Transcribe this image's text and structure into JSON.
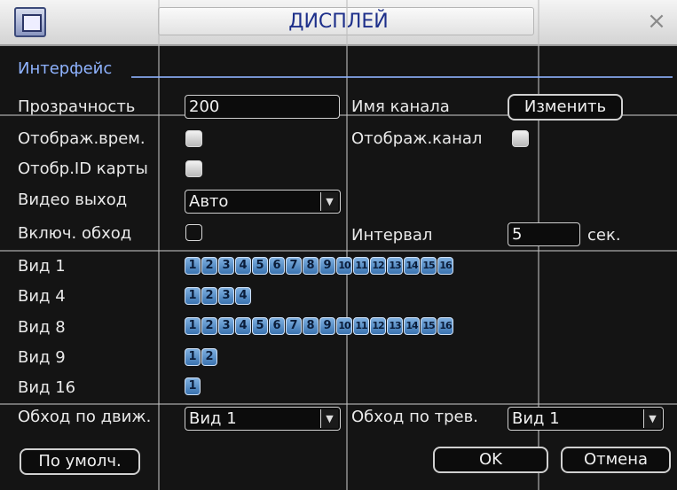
{
  "window": {
    "title": "ДИСПЛЕЙ"
  },
  "section": {
    "label": "Интерфейс"
  },
  "transparency": {
    "label": "Прозрачность",
    "value": "200"
  },
  "channel_name": {
    "label": "Имя канала",
    "button": "Изменить"
  },
  "show_time": {
    "label": "Отображ.врем.",
    "checked": true
  },
  "show_channel": {
    "label": "Отображ.канал",
    "checked": true
  },
  "show_card_id": {
    "label": "Отобр.ID карты",
    "checked": true
  },
  "video_out": {
    "label": "Видео выход",
    "value": "Авто"
  },
  "tour": {
    "label": "Включ. обход",
    "checked": false
  },
  "interval": {
    "label": "Интервал",
    "value": "5",
    "unit": "сек."
  },
  "views": [
    {
      "label": "Вид 1",
      "channels": [
        "1",
        "2",
        "3",
        "4",
        "5",
        "6",
        "7",
        "8",
        "9",
        "10",
        "11",
        "12",
        "13",
        "14",
        "15",
        "16"
      ]
    },
    {
      "label": "Вид 4",
      "channels": [
        "1",
        "2",
        "3",
        "4"
      ]
    },
    {
      "label": "Вид 8",
      "channels": [
        "1",
        "2",
        "3",
        "4",
        "5",
        "6",
        "7",
        "8",
        "9",
        "10",
        "11",
        "12",
        "13",
        "14",
        "15",
        "16"
      ]
    },
    {
      "label": "Вид 9",
      "channels": [
        "1",
        "2"
      ]
    },
    {
      "label": "Вид 16",
      "channels": [
        "1"
      ]
    }
  ],
  "motion_tour": {
    "label": "Обход по движ.",
    "value": "Вид 1"
  },
  "alarm_tour": {
    "label": "Обход по трев.",
    "value": "Вид 1"
  },
  "buttons": {
    "default": "По умолч.",
    "ok": "OK",
    "cancel": "Отмена"
  },
  "colors": {
    "accent": "#8fb3ff",
    "title": "#1d2f8a",
    "channel_button": "#5a92cc"
  }
}
